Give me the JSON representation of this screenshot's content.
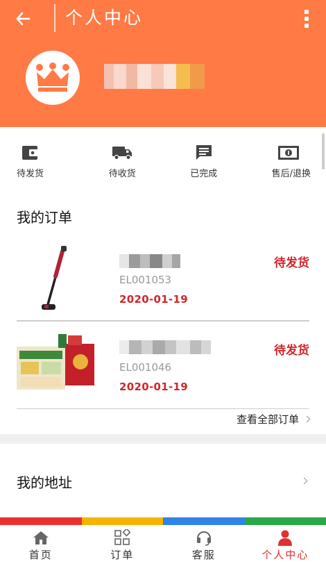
{
  "header": {
    "title": "个人中心",
    "back_icon": "arrow-left-icon",
    "more_icon": "more-vertical-icon",
    "background": "#ff7a45"
  },
  "status_tabs": [
    {
      "label": "待发货",
      "icon": "wallet-icon"
    },
    {
      "label": "待收货",
      "icon": "truck-icon"
    },
    {
      "label": "已完成",
      "icon": "message-icon"
    },
    {
      "label": "售后/退换",
      "icon": "banknote-icon"
    }
  ],
  "orders": {
    "title": "我的订单",
    "items": [
      {
        "order_no": "EL001053",
        "date": "2020-01-19",
        "status": "待发货"
      },
      {
        "order_no": "EL001046",
        "date": "2020-01-19",
        "status": "待发货"
      }
    ],
    "view_all": "查看全部订单"
  },
  "address": {
    "title": "我的地址"
  },
  "bottom_nav": [
    {
      "label": "首页",
      "icon": "home-icon",
      "active": false
    },
    {
      "label": "订单",
      "icon": "grid-icon",
      "active": false
    },
    {
      "label": "客服",
      "icon": "headset-icon",
      "active": false
    },
    {
      "label": "个人中心",
      "icon": "user-icon",
      "active": true
    }
  ],
  "colors": {
    "accent": "#ff7a45",
    "status_red": "#d0262b",
    "strip": [
      "#e8312e",
      "#f5b400",
      "#2f84e6",
      "#2aa84a"
    ]
  }
}
